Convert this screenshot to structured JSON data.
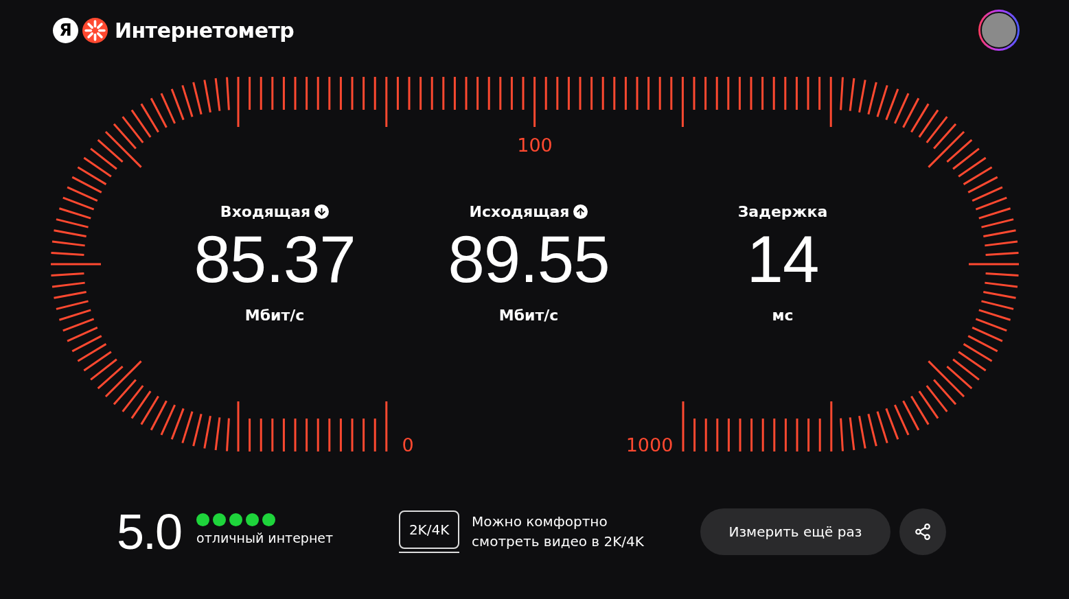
{
  "header": {
    "logo_letter": "Я",
    "title": "Интернетометр"
  },
  "gauge": {
    "scale_labels": [
      {
        "kind": "top",
        "text": "100"
      },
      {
        "kind": "left",
        "text": "0"
      },
      {
        "kind": "right",
        "text": "1000"
      }
    ]
  },
  "metrics": [
    {
      "label": "Входящая",
      "kind": "down",
      "value": "85.37",
      "unit": "Мбит/с"
    },
    {
      "label": "Исходящая",
      "kind": "up",
      "value": "89.55",
      "unit": "Мбит/с"
    },
    {
      "label": "Задержка",
      "kind": "plain",
      "value": "14",
      "unit": "мс"
    }
  ],
  "rating": {
    "score": "5.0",
    "stars": 5,
    "caption": "отличный интернет"
  },
  "quality": {
    "badge": "2K/4K",
    "lines": [
      "Можно комфортно",
      "смотреть видео в 2K/4K"
    ]
  },
  "actions": {
    "retest_button": "Измерить ещё раз"
  }
}
